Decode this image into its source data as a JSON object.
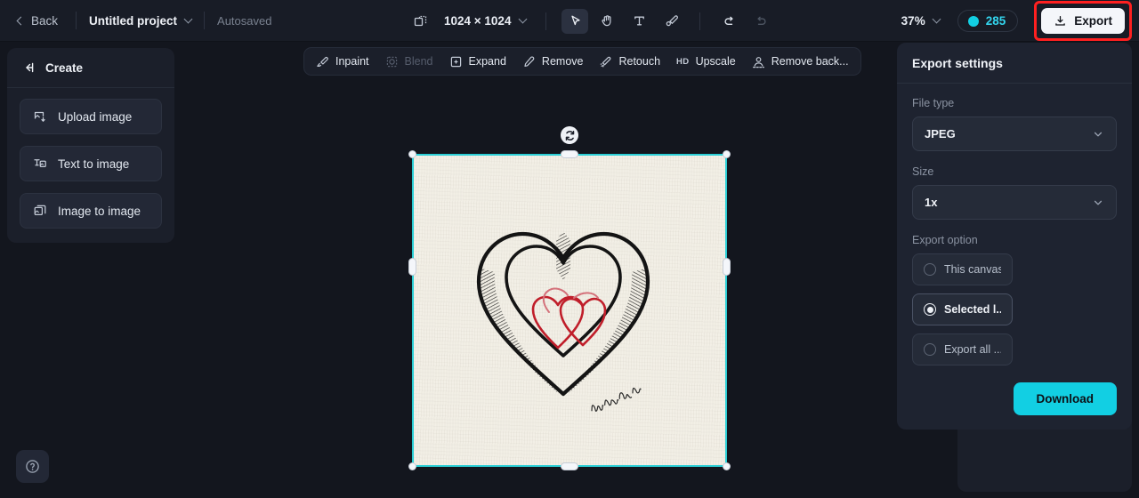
{
  "topbar": {
    "back_label": "Back",
    "project_name": "Untitled project",
    "autosaved_label": "Autosaved",
    "canvas_size": "1024 × 1024",
    "zoom_level": "37%",
    "credits": "285",
    "export_label": "Export",
    "icons": {
      "back_chevron": "chevron-left-icon",
      "project_chevron": "chevron-down-icon",
      "frame": "frame-icon",
      "select": "cursor-select-icon",
      "hand": "hand-icon",
      "text": "text-icon",
      "brush": "brush-icon",
      "undo": "undo-icon",
      "redo": "redo-icon",
      "coin": "credit-coin-icon",
      "download": "download-icon"
    },
    "tools": [
      {
        "name": "select-tool",
        "active": true
      },
      {
        "name": "hand-tool",
        "active": false
      },
      {
        "name": "text-tool",
        "active": false
      },
      {
        "name": "brush-tool",
        "active": false
      }
    ],
    "history": [
      {
        "name": "undo-button",
        "enabled": true
      },
      {
        "name": "redo-button",
        "enabled": false
      }
    ]
  },
  "sidebar": {
    "title": "Create",
    "collapse_icon": "collapse-panel-icon",
    "items": [
      {
        "label": "Upload image",
        "icon": "upload-image-icon"
      },
      {
        "label": "Text to image",
        "icon": "text-to-image-icon"
      },
      {
        "label": "Image to image",
        "icon": "image-to-image-icon"
      }
    ]
  },
  "float_toolbar": {
    "items": [
      {
        "label": "Inpaint",
        "icon": "inpaint-icon",
        "disabled": false
      },
      {
        "label": "Blend",
        "icon": "blend-icon",
        "disabled": true
      },
      {
        "label": "Expand",
        "icon": "expand-icon",
        "disabled": false
      },
      {
        "label": "Remove",
        "icon": "remove-icon",
        "disabled": false
      },
      {
        "label": "Retouch",
        "icon": "retouch-icon",
        "disabled": false
      },
      {
        "label": "Upscale",
        "icon": "hd-upscale-icon",
        "disabled": false
      },
      {
        "label": "Remove back...",
        "icon": "remove-background-icon",
        "disabled": false
      }
    ],
    "upscale_badge": "HD"
  },
  "canvas": {
    "rotate_icon": "rotate-icon",
    "selection_color": "#2bcfd6",
    "artwork": {
      "description": "pencil drawing of a large outlined heart with hatched shading containing two overlapping red heart outlines, signed in cursive",
      "paper_color": "#f2efe6",
      "outline_color": "#141414",
      "accent_color": "#c01e2a"
    }
  },
  "export_panel": {
    "title": "Export settings",
    "file_type_label": "File type",
    "file_type_value": "JPEG",
    "size_label": "Size",
    "size_value": "1x",
    "export_option_label": "Export option",
    "options": [
      {
        "label": "This canvas",
        "selected": false
      },
      {
        "label": "Selected l...",
        "selected": true
      },
      {
        "label": "Export all ...",
        "selected": false
      }
    ],
    "download_label": "Download",
    "accent_color": "#12cfe3"
  },
  "help": {
    "icon": "help-question-icon"
  }
}
